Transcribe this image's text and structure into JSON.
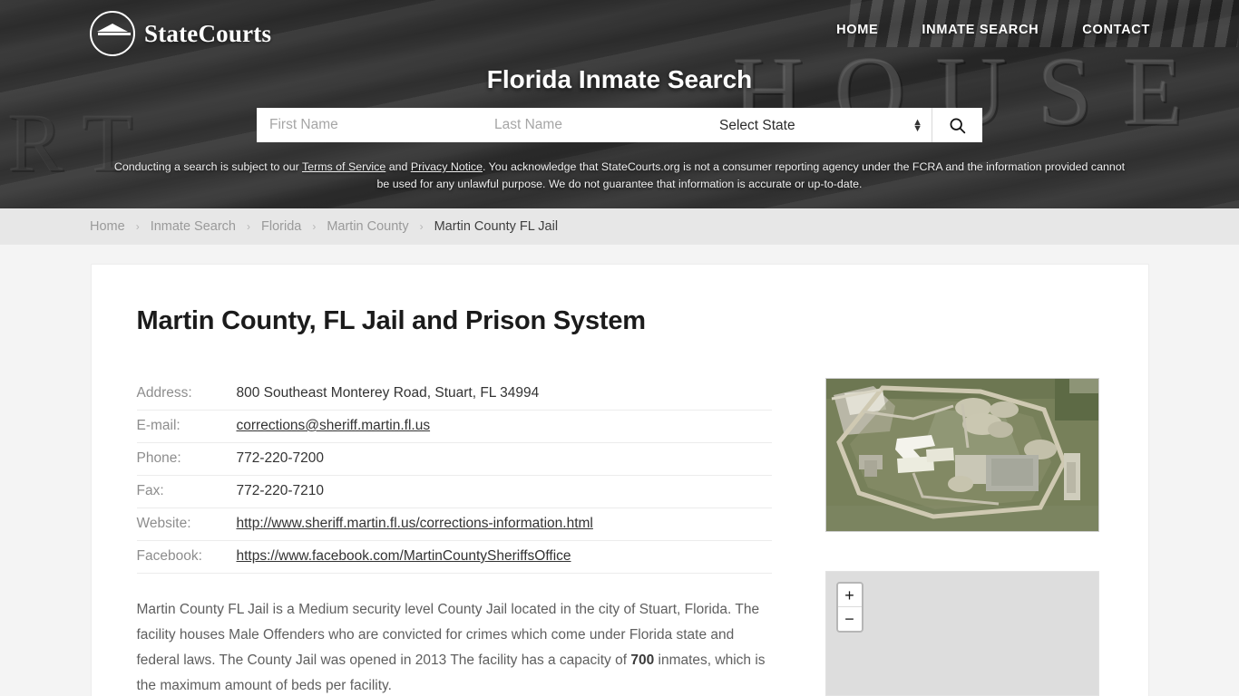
{
  "site": {
    "brand_name": "StateCourts",
    "logo_icon": "courthouse-circle-icon"
  },
  "nav": {
    "items": [
      {
        "label": "HOME"
      },
      {
        "label": "INMATE SEARCH"
      },
      {
        "label": "CONTACT"
      }
    ]
  },
  "hero": {
    "heading": "Florida Inmate Search",
    "background_carved_text": "HOUSE",
    "background_carved_text_left": "RT"
  },
  "search": {
    "first_name_placeholder": "First Name",
    "first_name_value": "",
    "last_name_placeholder": "Last Name",
    "last_name_value": "",
    "state_selected": "Select State",
    "state_options": [
      "Select State"
    ],
    "search_icon": "magnifier-icon",
    "stepper_icon": "chevron-up-down-icon"
  },
  "disclaimer": {
    "part1": "Conducting a search is subject to our ",
    "terms_link": "Terms of Service",
    "part2": " and ",
    "privacy_link": "Privacy Notice",
    "part3": ". You acknowledge that StateCourts.org is not a consumer reporting agency under the FCRA and the information provided cannot be used for any unlawful purpose. We do not guarantee that information is accurate or up-to-date."
  },
  "breadcrumb": {
    "separator": "›",
    "items": [
      {
        "label": "Home",
        "current": false
      },
      {
        "label": "Inmate Search",
        "current": false
      },
      {
        "label": "Florida",
        "current": false
      },
      {
        "label": "Martin County",
        "current": false
      },
      {
        "label": "Martin County FL Jail",
        "current": true
      }
    ]
  },
  "page": {
    "title": "Martin County, FL Jail and Prison System"
  },
  "facts": {
    "rows": [
      {
        "label": "Address:",
        "value": "800 Southeast Monterey Road, Stuart, FL 34994",
        "link": false
      },
      {
        "label": "E-mail:",
        "value": "corrections@sheriff.martin.fl.us",
        "link": true
      },
      {
        "label": "Phone:",
        "value": "772-220-7200",
        "link": false
      },
      {
        "label": "Fax:",
        "value": "772-220-7210",
        "link": false
      },
      {
        "label": "Website:",
        "value": "http://www.sheriff.martin.fl.us/corrections-information.html",
        "link": true
      },
      {
        "label": "Facebook:",
        "value": "https://www.facebook.com/MartinCountySheriffsOffice",
        "link": true
      }
    ]
  },
  "description": {
    "text_before": "Martin County FL Jail is a Medium security level County Jail located in the city of Stuart, Florida. The facility houses Male Offenders who are convicted for crimes which come under Florida state and federal laws. The County Jail was opened in 2013 The facility has a capacity of ",
    "capacity": "700",
    "text_after": " inmates, which is the maximum amount of beds per facility."
  },
  "media": {
    "aerial_photo_alt": "aerial-view-of-jail-facility",
    "map_zoom_in_label": "+",
    "map_zoom_out_label": "−"
  },
  "colors": {
    "page_background": "#f4f4f4",
    "card_background": "#ffffff",
    "breadcrumb_background": "#e7e7e7",
    "header_overlay": "#3a3a3a",
    "label_text": "#8d8d8d",
    "body_text": "#5f5f5f",
    "map_placeholder": "#dddddd"
  }
}
